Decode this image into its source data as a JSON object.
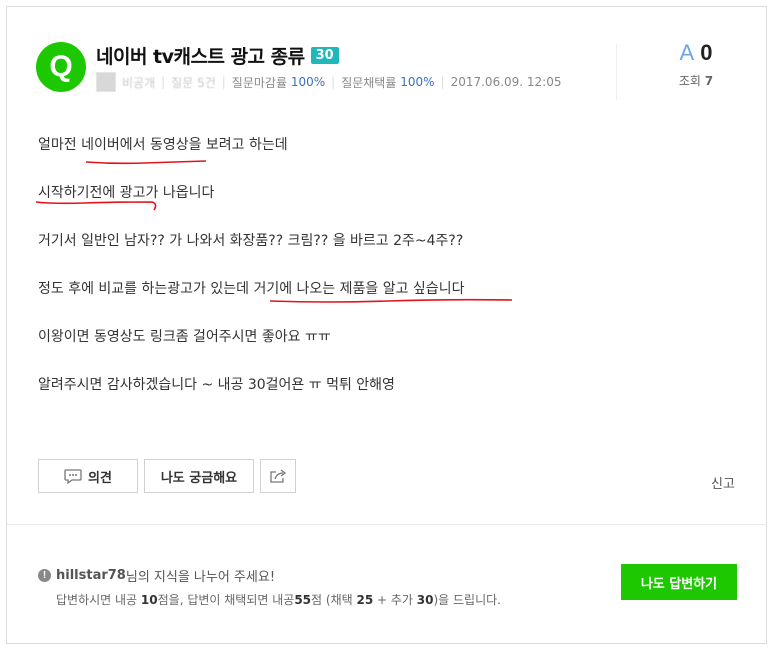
{
  "question": {
    "avatar_letter": "Q",
    "title": "네이버 tv캐스트 광고 종류",
    "bounty": "30",
    "author_name": "비공개",
    "author_count": "질문 5건",
    "close_rate_label": "질문마감률",
    "close_rate": "100%",
    "adopt_rate_label": "질문채택률",
    "adopt_rate": "100%",
    "date": "2017.06.09. 12:05"
  },
  "stats": {
    "answer_icon": "A",
    "answer_count": "0",
    "views_label": "조회",
    "views": "7"
  },
  "body": {
    "lines": [
      "얼마전 네이버에서 동영상을 보려고 하는데",
      "시작하기전에 광고가 나옵니다",
      "거기서 일반인 남자?? 가 나와서 화장품?? 크림?? 을 바르고 2주~4주??",
      "정도 후에 비교를 하는광고가 있는데 거기에 나오는 제품을 알고 싶습니다",
      "이왕이면 동영상도 링크좀 걸어주시면 좋아요 ㅠㅠ",
      "알려주시면 감사하겠습니다 ~ 내공 30걸어욘 ㅠ 먹튀 안해영"
    ]
  },
  "actions": {
    "comment_label": "의견",
    "me_too_label": "나도 궁금해요",
    "share_icon": "share-icon",
    "report_label": "신고"
  },
  "footer": {
    "user": "hillstar78",
    "line1_suffix": "님의 지식을 나누어 주세요!",
    "line2_a": "답변하시면 내공 ",
    "points_answer": "10",
    "line2_b": "점을, 답변이 채택되면 내공",
    "points_total": "55",
    "line2_c": "점 (채택 ",
    "points_adopt": "25",
    "line2_d": " + 추가 ",
    "points_extra": "30",
    "line2_e": ")을 드립니다.",
    "answer_button": "나도 답변하기"
  },
  "colors": {
    "brand_green": "#1ec800",
    "bounty_teal": "#20b7b9",
    "annotation_red": "#e0141e"
  }
}
